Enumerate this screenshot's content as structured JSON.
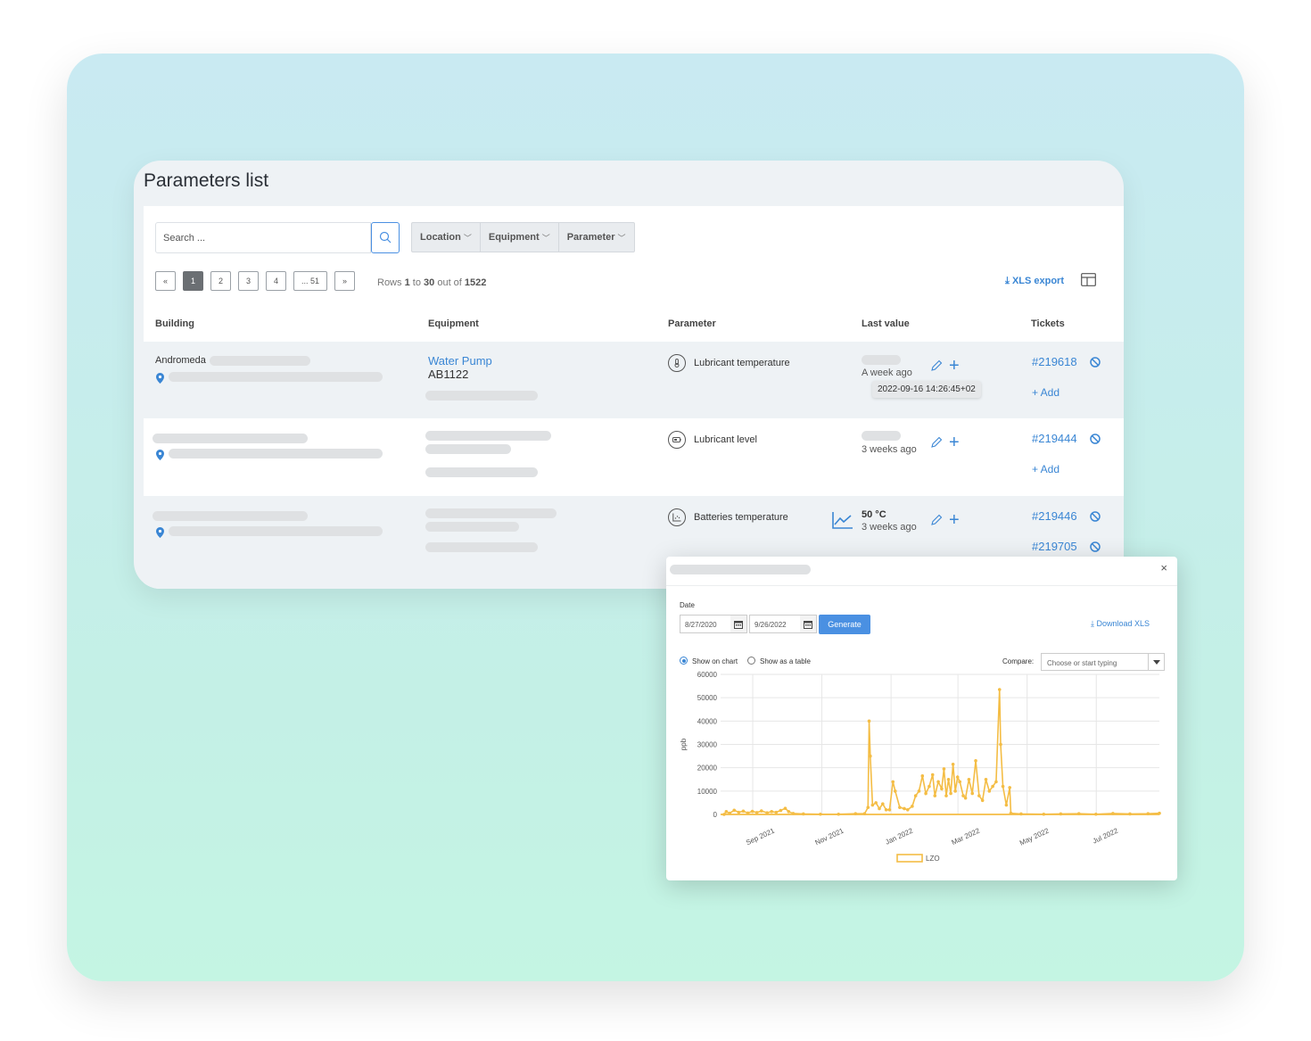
{
  "page": {
    "title": "Parameters list"
  },
  "toolbar": {
    "search_placeholder": "Search ...",
    "filters": [
      "Location",
      "Equipment",
      "Parameter"
    ],
    "xls_export": "XLS export"
  },
  "pagination": {
    "prev": "«",
    "pages": [
      "1",
      "2",
      "3",
      "4",
      "... 51"
    ],
    "next": "»",
    "active_page": "1",
    "rows_prefix": "Rows",
    "rows_from": "1",
    "rows_to_word": "to",
    "rows_to": "30",
    "rows_out_of": "out of",
    "rows_total": "1522"
  },
  "table": {
    "headers": {
      "building": "Building",
      "equipment": "Equipment",
      "parameter": "Parameter",
      "last_value": "Last value",
      "tickets": "Tickets"
    },
    "rows": [
      {
        "building": "Andromeda",
        "equipment_name": "Water Pump",
        "equipment_id": "AB1122",
        "parameter": "Lubricant temperature",
        "parameter_icon": "thermometer-icon",
        "last_value": "",
        "ago": "A week ago",
        "tooltip": "2022-09-16 14:26:45+02",
        "tickets": [
          "#219618"
        ],
        "add": "+ Add"
      },
      {
        "building": "",
        "equipment_name": "",
        "equipment_id": "",
        "parameter": "Lubricant level",
        "parameter_icon": "battery-level-icon",
        "last_value": "",
        "ago": "3 weeks ago",
        "tickets": [
          "#219444"
        ],
        "add": "+ Add"
      },
      {
        "building": "",
        "equipment_name": "",
        "equipment_id": "",
        "parameter": "Batteries temperature",
        "parameter_icon": "chart-grid-icon",
        "last_value": "50 °C",
        "ago": "3 weeks ago",
        "tickets": [
          "#219446",
          "#219705"
        ]
      }
    ]
  },
  "modal": {
    "close": "×",
    "date_label": "Date",
    "date_from": "8/27/2020",
    "date_to": "9/26/2022",
    "generate": "Generate",
    "download_xls": "Download XLS",
    "show_on_chart": "Show on chart",
    "show_as_table": "Show as a table",
    "compare_label": "Compare:",
    "compare_placeholder": "Choose or start typing"
  },
  "colors": {
    "accent": "#3a86d4",
    "series": "#f4bd45"
  },
  "chart_data": {
    "type": "line",
    "ylabel": "ppb",
    "ylim": [
      0,
      60000
    ],
    "yticks": [
      "0",
      "10000",
      "20000",
      "30000",
      "40000",
      "50000",
      "60000"
    ],
    "xticks": [
      "Sep 2021",
      "Nov 2021",
      "Jan 2022",
      "Mar 2022",
      "May 2022",
      "Jul 2022"
    ],
    "grid": true,
    "legend": "bottom",
    "series": [
      {
        "name": "LZO",
        "points": [
          [
            "2021-08-01",
            0
          ],
          [
            "2021-08-03",
            1200
          ],
          [
            "2021-08-06",
            500
          ],
          [
            "2021-08-10",
            1800
          ],
          [
            "2021-08-14",
            900
          ],
          [
            "2021-08-18",
            1400
          ],
          [
            "2021-08-22",
            600
          ],
          [
            "2021-08-26",
            1300
          ],
          [
            "2021-08-30",
            800
          ],
          [
            "2021-09-03",
            1500
          ],
          [
            "2021-09-08",
            700
          ],
          [
            "2021-09-12",
            1200
          ],
          [
            "2021-09-16",
            900
          ],
          [
            "2021-09-20",
            1700
          ],
          [
            "2021-09-24",
            2600
          ],
          [
            "2021-09-27",
            1200
          ],
          [
            "2021-10-01",
            400
          ],
          [
            "2021-10-10",
            200
          ],
          [
            "2021-10-25",
            100
          ],
          [
            "2021-11-10",
            100
          ],
          [
            "2021-11-25",
            300
          ],
          [
            "2021-12-03",
            300
          ],
          [
            "2021-12-06",
            3000
          ],
          [
            "2021-12-07",
            40000
          ],
          [
            "2021-12-08",
            25000
          ],
          [
            "2021-12-10",
            4000
          ],
          [
            "2021-12-13",
            5000
          ],
          [
            "2021-12-16",
            2500
          ],
          [
            "2021-12-19",
            4500
          ],
          [
            "2021-12-22",
            2000
          ],
          [
            "2021-12-25",
            2000
          ],
          [
            "2021-12-28",
            14000
          ],
          [
            "2021-12-30",
            10000
          ],
          [
            "2022-01-03",
            3000
          ],
          [
            "2022-01-07",
            2500
          ],
          [
            "2022-01-10",
            2000
          ],
          [
            "2022-01-14",
            3500
          ],
          [
            "2022-01-17",
            8000
          ],
          [
            "2022-01-20",
            10000
          ],
          [
            "2022-01-23",
            16500
          ],
          [
            "2022-01-26",
            9000
          ],
          [
            "2022-01-29",
            12000
          ],
          [
            "2022-02-01",
            17000
          ],
          [
            "2022-02-03",
            8000
          ],
          [
            "2022-02-06",
            14000
          ],
          [
            "2022-02-09",
            11000
          ],
          [
            "2022-02-11",
            19500
          ],
          [
            "2022-02-13",
            8000
          ],
          [
            "2022-02-15",
            15000
          ],
          [
            "2022-02-17",
            9000
          ],
          [
            "2022-02-19",
            21500
          ],
          [
            "2022-02-21",
            10000
          ],
          [
            "2022-02-23",
            16000
          ],
          [
            "2022-02-25",
            14000
          ],
          [
            "2022-02-28",
            8000
          ],
          [
            "2022-03-02",
            7000
          ],
          [
            "2022-03-05",
            15000
          ],
          [
            "2022-03-08",
            9000
          ],
          [
            "2022-03-11",
            23000
          ],
          [
            "2022-03-14",
            8000
          ],
          [
            "2022-03-17",
            6000
          ],
          [
            "2022-03-20",
            15000
          ],
          [
            "2022-03-23",
            10000
          ],
          [
            "2022-03-26",
            12000
          ],
          [
            "2022-03-29",
            14000
          ],
          [
            "2022-04-01",
            53500
          ],
          [
            "2022-04-02",
            30000
          ],
          [
            "2022-04-04",
            12000
          ],
          [
            "2022-04-07",
            4000
          ],
          [
            "2022-04-10",
            11500
          ],
          [
            "2022-04-11",
            500
          ],
          [
            "2022-04-20",
            200
          ],
          [
            "2022-05-10",
            100
          ],
          [
            "2022-05-25",
            200
          ],
          [
            "2022-06-10",
            300
          ],
          [
            "2022-06-25",
            100
          ],
          [
            "2022-07-10",
            400
          ],
          [
            "2022-07-25",
            200
          ],
          [
            "2022-08-10",
            300
          ],
          [
            "2022-08-20",
            500
          ]
        ]
      }
    ]
  }
}
